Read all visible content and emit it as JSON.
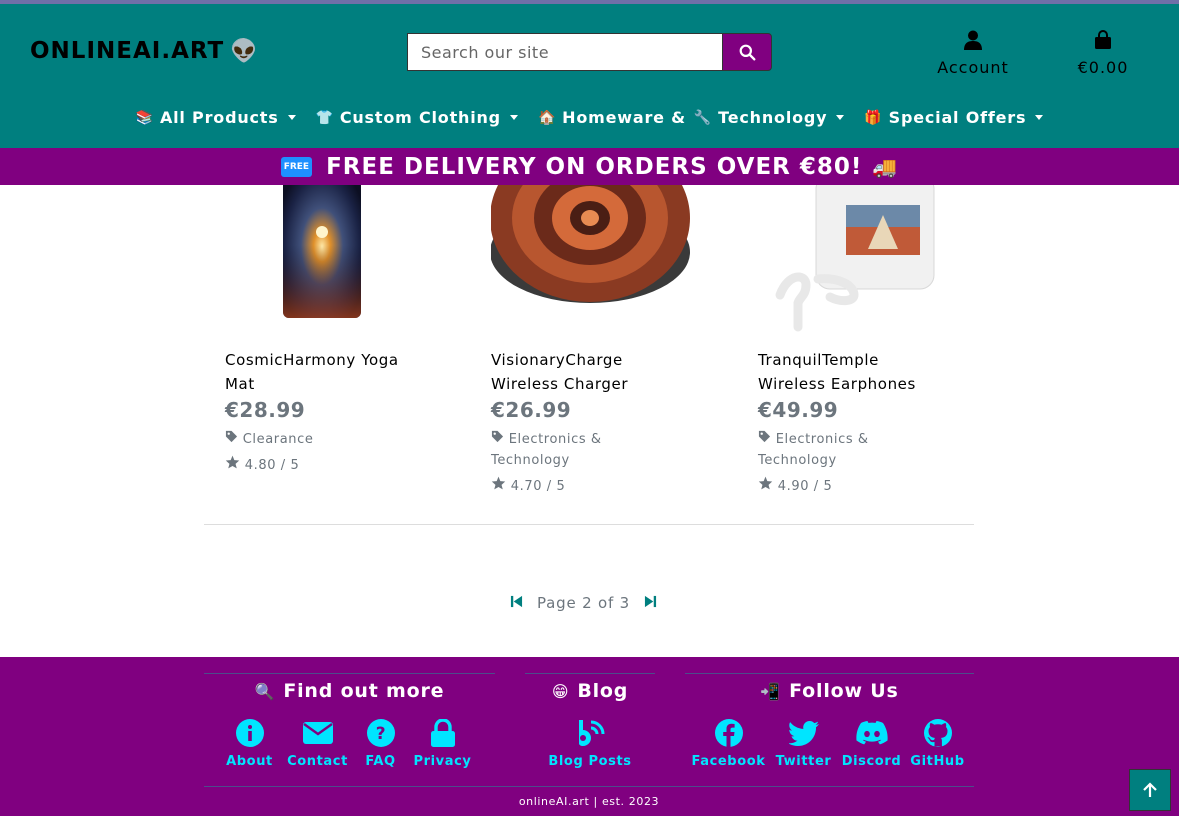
{
  "colors": {
    "header_bg": "#007f7f",
    "accent_purple": "#800080",
    "link_cyan": "#00e5ff",
    "price_gray": "#6c757d"
  },
  "header": {
    "logo": "ONLINEAI.ART",
    "logo_icon": "alien-emoji",
    "search": {
      "placeholder": "Search our site",
      "value": ""
    },
    "account_label": "Account",
    "cart_total": "€0.00"
  },
  "nav": [
    {
      "label": "All Products",
      "icon": "📚"
    },
    {
      "label": "Custom Clothing",
      "icon": "👕"
    },
    {
      "label": "Homeware &",
      "icon": "🏠",
      "label2": "Technology",
      "icon2": "🔧"
    },
    {
      "label": "Special Offers",
      "icon": "🎁"
    }
  ],
  "promo": {
    "badge": "FREE",
    "text": "FREE DELIVERY ON ORDERS OVER €80!",
    "icon": "🚚"
  },
  "products": [
    {
      "name_line1": "CosmicHarmony Yoga",
      "name_line2": "Mat",
      "price": "€28.99",
      "category_line1": "Clearance",
      "category_line2": "",
      "rating": "4.80 / 5"
    },
    {
      "name_line1": "VisionaryCharge",
      "name_line2": "Wireless Charger",
      "price": "€26.99",
      "category_line1": "Electronics &",
      "category_line2": "Technology",
      "rating": "4.70 / 5"
    },
    {
      "name_line1": "TranquilTemple",
      "name_line2": "Wireless Earphones",
      "price": "€49.99",
      "category_line1": "Electronics &",
      "category_line2": "Technology",
      "rating": "4.90 / 5"
    }
  ],
  "pagination": {
    "text": "Page 2 of 3",
    "current": 2,
    "total": 3
  },
  "footer": {
    "find_out_more": {
      "title": "Find out more",
      "icon": "🔍",
      "links": [
        "About",
        "Contact",
        "FAQ",
        "Privacy"
      ]
    },
    "blog": {
      "title": "Blog",
      "icon": "😁",
      "links": [
        "Blog Posts"
      ]
    },
    "follow": {
      "title": "Follow Us",
      "icon": "📲",
      "links": [
        "Facebook",
        "Twitter",
        "Discord",
        "GitHub"
      ]
    },
    "copyright": "onlineAI.art | est. 2023"
  }
}
